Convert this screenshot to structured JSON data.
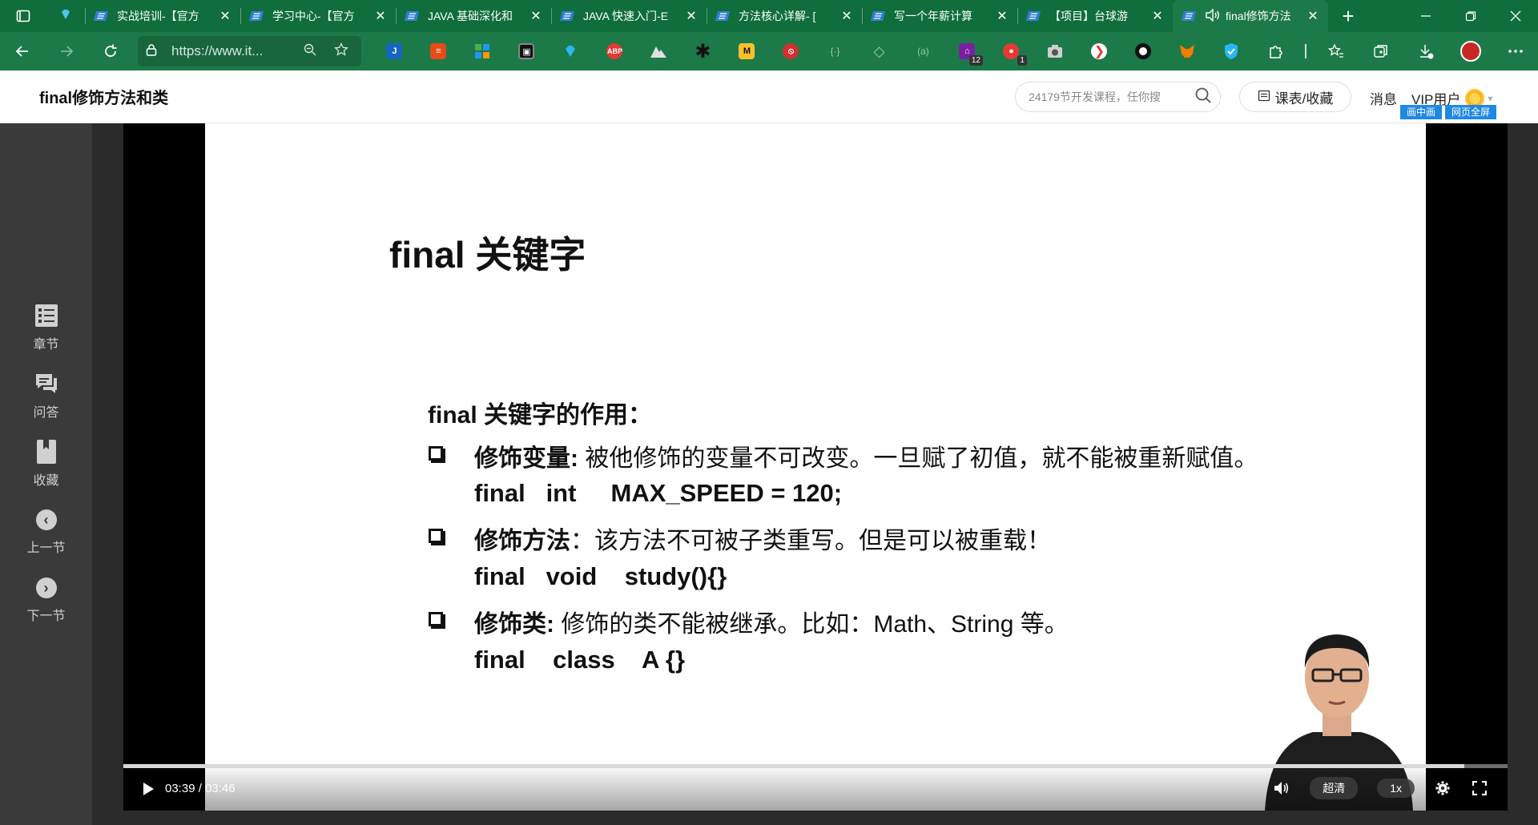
{
  "browser": {
    "tabs": [
      {
        "title": "实战培训-【官方",
        "active": false
      },
      {
        "title": "学习中心-【官方",
        "active": false
      },
      {
        "title": "JAVA 基础深化和",
        "active": false
      },
      {
        "title": "JAVA 快速入门-E",
        "active": false
      },
      {
        "title": "方法核心详解- [",
        "active": false
      },
      {
        "title": "写一个年薪计算",
        "active": false
      },
      {
        "title": "【项目】台球游",
        "active": false
      },
      {
        "title": "final修饰方法",
        "active": true
      }
    ],
    "tab_close_glyph": "✕",
    "new_tab_glyph": "+",
    "url": "https://www.it...",
    "extension_badges": {
      "ext_purple": "12",
      "ext_chat": "1"
    }
  },
  "header": {
    "title": "final修饰方法和类",
    "search_placeholder": "24179节开发课程，任你搜",
    "course_button": "课表/收藏",
    "messages": "消息",
    "vip": "VIP用户",
    "pip_badge": "画中画",
    "fullpage_badge": "网页全屏"
  },
  "sidenav": {
    "items": [
      {
        "label": "章节",
        "icon": "chapters-icon"
      },
      {
        "label": "问答",
        "icon": "qa-icon"
      },
      {
        "label": "收藏",
        "icon": "bookmark-icon"
      },
      {
        "label": "上一节",
        "icon": "prev-lesson-icon",
        "glyph": "‹"
      },
      {
        "label": "下一节",
        "icon": "next-lesson-icon",
        "glyph": "›"
      }
    ]
  },
  "slide": {
    "title": "final 关键字",
    "subtitle": "final 关键字的作用：",
    "points": [
      {
        "label": "修饰变量:",
        "text": " 被他修饰的变量不可改变。一旦赋了初值，就不能被重新赋值。",
        "code": "final   int     MAX_SPEED = 120;"
      },
      {
        "label": "修饰方法",
        "text": "：该方法不可被子类重写。但是可以被重载！",
        "code": "final   void    study(){}"
      },
      {
        "label": "修饰类:",
        "text": " 修饰的类不能被继承。比如：Math、String 等。",
        "code": "final    class    A {}"
      }
    ]
  },
  "player": {
    "time": "03:39 / 03:46",
    "progress": 0.969,
    "quality": "超清",
    "speed": "1x"
  },
  "colors": {
    "browser_green": "#1c7a48",
    "tab_green": "#0f6e3c",
    "badge_blue": "#1e88e5",
    "sidenav_bg": "#3a3a3a"
  }
}
